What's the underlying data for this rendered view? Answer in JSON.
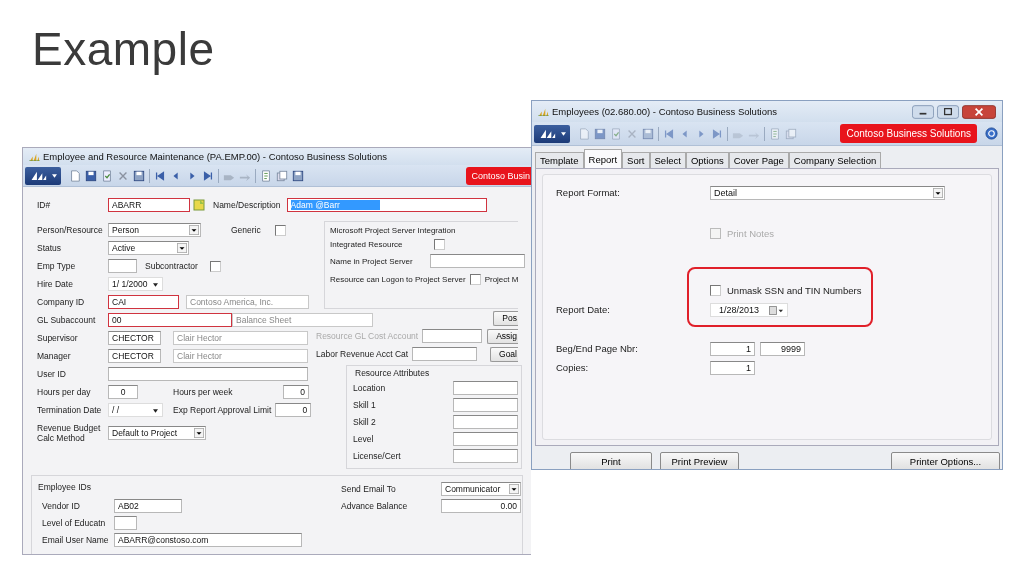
{
  "slide_title": "Example",
  "employee_window": {
    "title": "Employee and Resource Maintenance (PA.EMP.00) - Contoso Business Solutions",
    "brand": "Contoso Busin",
    "id": {
      "label": "ID#",
      "value": "ABARR",
      "required": true
    },
    "name": {
      "label": "Name/Description",
      "value": "Adam @Barr",
      "required": true,
      "highlighted": true
    },
    "person_resource": {
      "label": "Person/Resource",
      "value": "Person"
    },
    "generic": {
      "label": "Generic",
      "checked": false
    },
    "status": {
      "label": "Status",
      "value": "Active"
    },
    "emp_type": {
      "label": "Emp Type"
    },
    "subcontractor": {
      "label": "Subcontractor",
      "checked": false
    },
    "hire_date": {
      "label": "Hire Date",
      "value": "1/ 1/2000"
    },
    "company_id": {
      "label": "Company ID",
      "value": "CAI",
      "required": true,
      "description": "Contoso America, Inc."
    },
    "gl_subaccount": {
      "label": "GL Subaccount",
      "value": "00",
      "required": true,
      "description": "Balance Sheet"
    },
    "supervisor": {
      "label": "Supervisor",
      "value": "CHECTOR",
      "description": "Clair Hector"
    },
    "manager": {
      "label": "Manager",
      "value": "CHECTOR",
      "description": "Clair Hector"
    },
    "user_id": {
      "label": "User ID"
    },
    "hours_per_day": {
      "label": "Hours per day",
      "value": "0"
    },
    "hours_per_week": {
      "label": "Hours per week",
      "value": "0"
    },
    "termination_date": {
      "label": "Termination Date",
      "value": "/ /"
    },
    "exp_limit": {
      "label": "Exp Report Approval Limit",
      "value": "0"
    },
    "revenue_budget": {
      "label": "Revenue Budget Calc Method",
      "value": "Default to Project"
    },
    "project_server": {
      "title": "Microsoft Project Server Integration",
      "integrated": {
        "label": "Integrated Resource",
        "checked": false
      },
      "name_in_server": {
        "label": "Name in Project Server"
      },
      "can_logon": {
        "label": "Resource can Logon to Project Server",
        "checked": false
      },
      "cut_label": "Project M"
    },
    "buttons": [
      "Pos",
      "Assig",
      "Goal"
    ],
    "resource_gl": {
      "label": "Resource GL Cost Account",
      "disabled": true
    },
    "labor_revenue": {
      "label": "Labor Revenue Acct Cat",
      "disabled": false
    },
    "resource_attributes": {
      "title": "Resource Attributes",
      "fields": [
        {
          "label": "Location"
        },
        {
          "label": "Skill 1"
        },
        {
          "label": "Skill 2"
        },
        {
          "label": "Level"
        },
        {
          "label": "License/Cert"
        }
      ]
    },
    "employee_ids": {
      "title": "Employee IDs",
      "fields": [
        {
          "label": "Vendor ID",
          "value": "AB02"
        },
        {
          "label": "Level of Educatn"
        },
        {
          "label": "Email User Name",
          "value": "ABARR@constoso.com"
        }
      ]
    },
    "send_email": {
      "label": "Send Email To",
      "value": "Communicator"
    },
    "advance_balance": {
      "label": "Advance Balance",
      "value": "0.00"
    }
  },
  "report_window": {
    "title": "Employees (02.680.00) - Contoso Business Solutions",
    "brand": "Contoso Business Solutions",
    "tabs": [
      {
        "label": "Template",
        "selected": false
      },
      {
        "label": "Report",
        "selected": true
      },
      {
        "label": "Sort",
        "selected": false
      },
      {
        "label": "Select",
        "selected": false
      },
      {
        "label": "Options",
        "selected": false
      },
      {
        "label": "Cover Page",
        "selected": false
      },
      {
        "label": "Company Selection",
        "selected": false
      }
    ],
    "report_format": {
      "label": "Report Format:",
      "value": "Detail"
    },
    "print_notes": {
      "label": "Print Notes",
      "checked": false,
      "disabled": true
    },
    "unmask": {
      "label": "Unmask SSN and TIN Numbers",
      "checked": false,
      "disabled": false
    },
    "report_date": {
      "label": "Report Date:",
      "value": "1/28/2013"
    },
    "page_range": {
      "label": "Beg/End Page Nbr:",
      "begin": "1",
      "end": "9999"
    },
    "copies": {
      "label": "Copies:",
      "value": "1"
    },
    "buttons": [
      "Print",
      "Print Preview",
      "Printer Options..."
    ]
  }
}
